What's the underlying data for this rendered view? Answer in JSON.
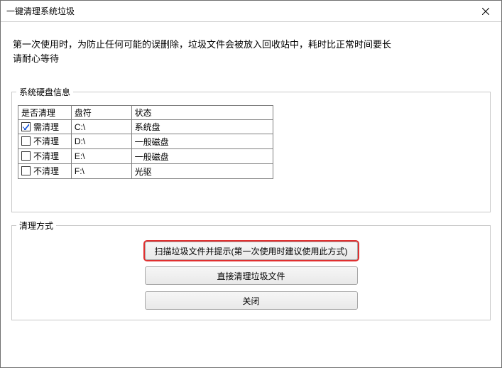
{
  "window": {
    "title": "一键清理系统垃圾"
  },
  "intro": {
    "line1": "第一次使用时，为防止任何可能的误删除，垃圾文件会被放入回收站中，耗时比正常时间要长",
    "line2": "请耐心等待"
  },
  "diskGroup": {
    "legend": "系统硬盘信息",
    "headers": {
      "check": "是否清理",
      "drive": "盘符",
      "state": "状态"
    },
    "rows": [
      {
        "checked": true,
        "label": "需清理",
        "drive": "C:\\",
        "state": "系统盘"
      },
      {
        "checked": false,
        "label": "不清理",
        "drive": "D:\\",
        "state": "一般磁盘"
      },
      {
        "checked": false,
        "label": "不清理",
        "drive": "E:\\",
        "state": "一般磁盘"
      },
      {
        "checked": false,
        "label": "不清理",
        "drive": "F:\\",
        "state": "光驱"
      }
    ]
  },
  "modeGroup": {
    "legend": "清理方式",
    "scan": "扫描垃圾文件并提示(第一次使用时建议使用此方式)",
    "direct": "直接清理垃圾文件",
    "close": "关闭"
  }
}
